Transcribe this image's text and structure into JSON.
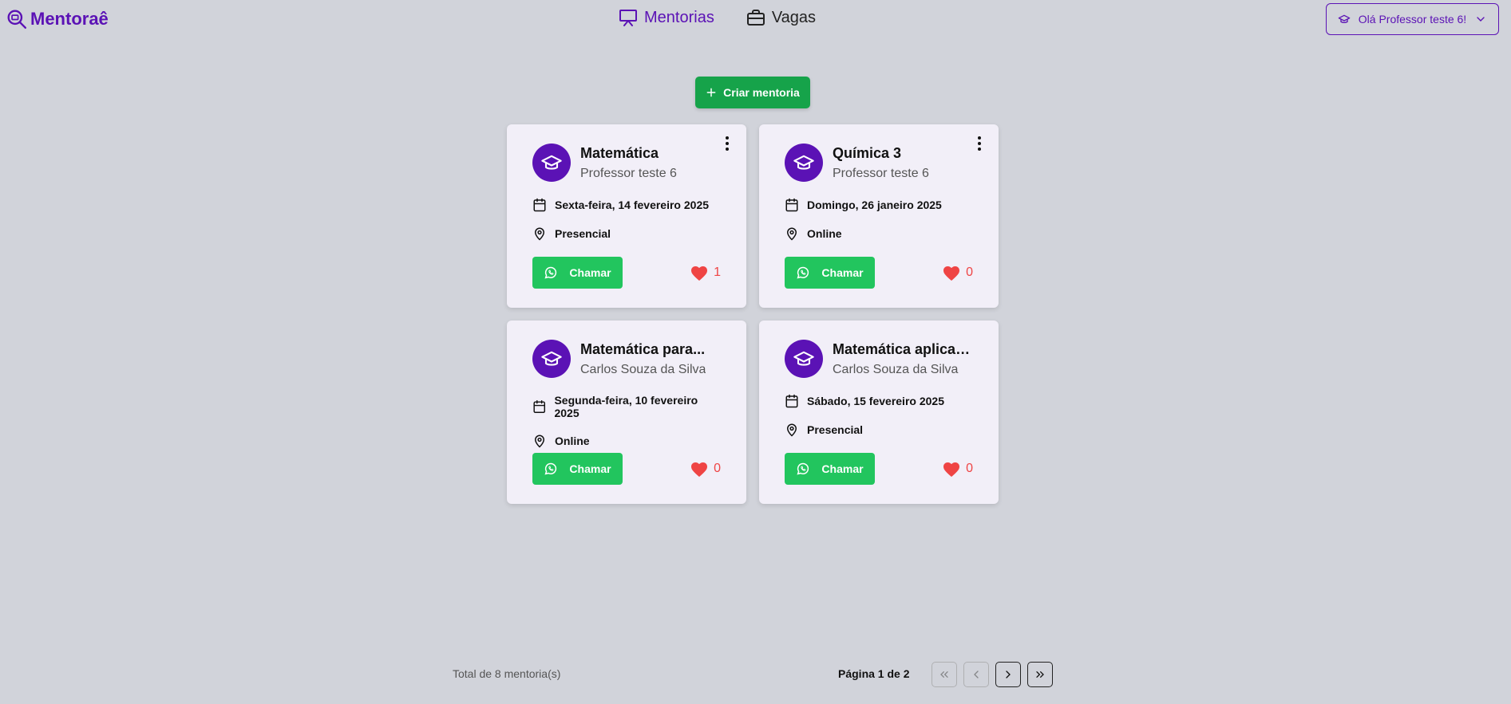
{
  "header": {
    "logo_text": "Mentoraê",
    "nav": [
      {
        "label": "Mentorias",
        "icon": "presentation-icon",
        "active": true
      },
      {
        "label": "Vagas",
        "icon": "briefcase-icon",
        "active": false
      }
    ],
    "user_menu_label": "Olá Professor teste 6!"
  },
  "toolbar": {
    "create_label": "Criar mentoria"
  },
  "cards": [
    {
      "title": "Matemática",
      "mentor": "Professor teste 6",
      "date": "Sexta-feira, 14 fevereiro 2025",
      "mode": "Presencial",
      "call_label": "Chamar",
      "likes": "1"
    },
    {
      "title": "Química 3",
      "mentor": "Professor teste 6",
      "date": "Domingo, 26 janeiro 2025",
      "mode": "Online",
      "call_label": "Chamar",
      "likes": "0"
    },
    {
      "title": "Matemática para...",
      "mentor": "Carlos Souza da Silva",
      "date": "Segunda-feira, 10 fevereiro 2025",
      "mode": "Online",
      "call_label": "Chamar",
      "likes": "0"
    },
    {
      "title": "Matemática aplicad...",
      "mentor": "Carlos Souza da Silva",
      "date": "Sábado, 15 fevereiro 2025",
      "mode": "Presencial",
      "call_label": "Chamar",
      "likes": "0"
    }
  ],
  "pagination": {
    "total_text": "Total de 8 mentoria(s)",
    "page_text": "Página 1 de 2"
  },
  "colors": {
    "brand": "#5b12b5",
    "create_button": "#16a34a",
    "call_button": "#22c55e",
    "like": "#ef4444",
    "background": "#d1d3da",
    "card": "#f2eff8"
  }
}
